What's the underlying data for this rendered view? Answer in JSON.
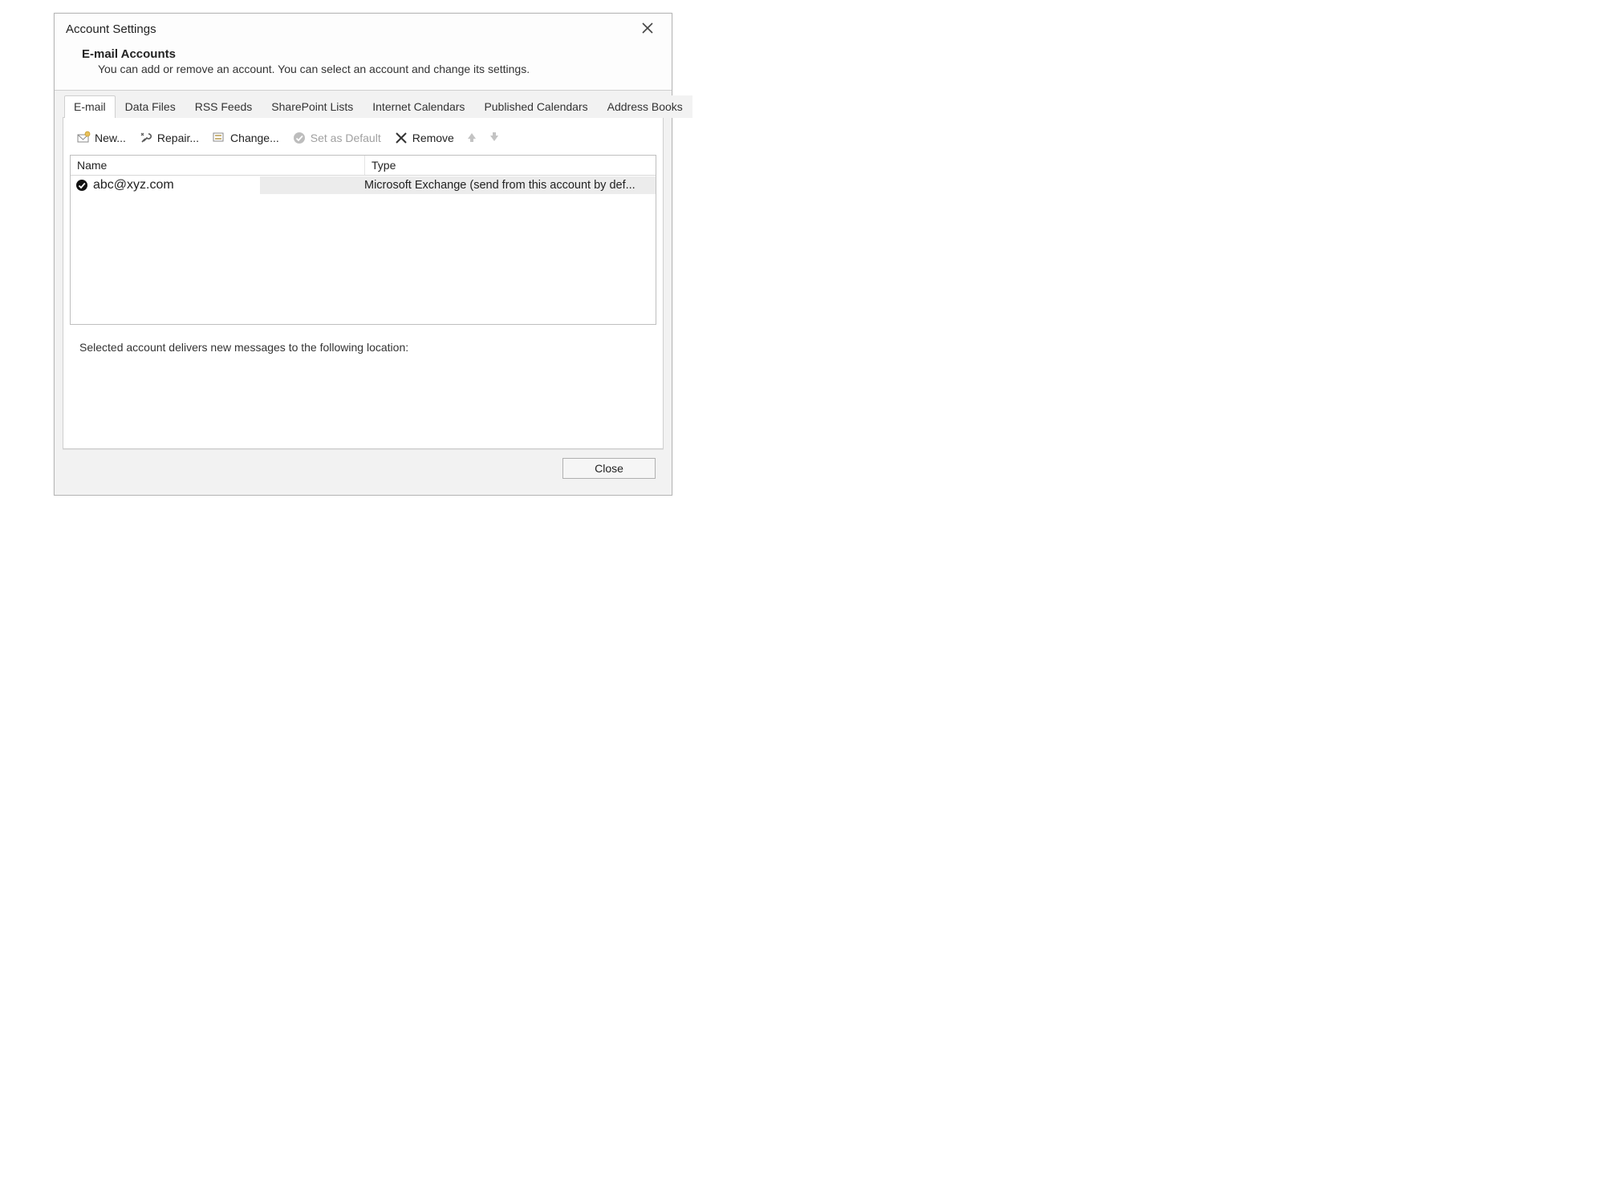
{
  "dialog": {
    "title": "Account Settings",
    "heading": "E-mail Accounts",
    "description": "You can add or remove an account. You can select an account and change its settings."
  },
  "tabs": [
    {
      "label": "E-mail",
      "active": true
    },
    {
      "label": "Data Files"
    },
    {
      "label": "RSS Feeds"
    },
    {
      "label": "SharePoint Lists"
    },
    {
      "label": "Internet Calendars"
    },
    {
      "label": "Published Calendars"
    },
    {
      "label": "Address Books"
    }
  ],
  "toolbar": {
    "new_label": "New...",
    "repair_label": "Repair...",
    "change_label": "Change...",
    "set_default_label": "Set as Default",
    "remove_label": "Remove"
  },
  "list": {
    "col_name": "Name",
    "col_type": "Type",
    "rows": [
      {
        "name": "abc@xyz.com",
        "type": "Microsoft Exchange (send from this account by def..."
      }
    ]
  },
  "location_text": "Selected account delivers new messages to the following location:",
  "buttons": {
    "close_label": "Close"
  }
}
